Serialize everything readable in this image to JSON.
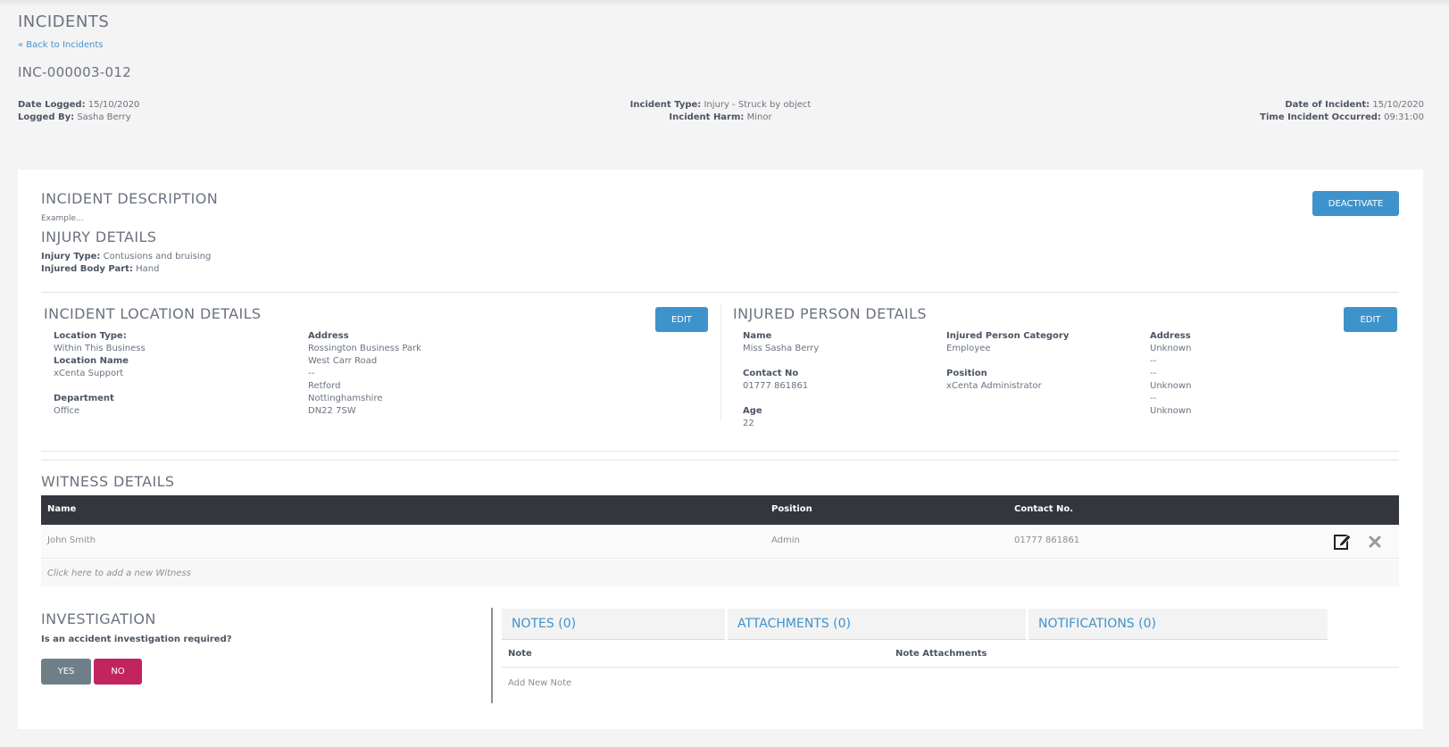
{
  "header": {
    "title": "INCIDENTS",
    "back_link": "« Back to Incidents",
    "reference": "INC-000003-012"
  },
  "meta": {
    "date_logged_label": "Date Logged:",
    "date_logged": "15/10/2020",
    "logged_by_label": "Logged By:",
    "logged_by": "Sasha Berry",
    "incident_type_label": "Incident Type:",
    "incident_type": "Injury - Struck by object",
    "incident_harm_label": "Incident Harm:",
    "incident_harm": "Minor",
    "date_of_incident_label": "Date of Incident:",
    "date_of_incident": "15/10/2020",
    "time_occurred_label": "Time Incident Occurred:",
    "time_occurred": "09:31:00"
  },
  "description": {
    "title": "INCIDENT DESCRIPTION",
    "text": "Example...",
    "deactivate_label": "DEACTIVATE"
  },
  "injury": {
    "title": "INJURY DETAILS",
    "type_label": "Injury Type:",
    "type": "Contusions and bruising",
    "body_part_label": "Injured Body Part:",
    "body_part": "Hand"
  },
  "location": {
    "title": "INCIDENT LOCATION DETAILS",
    "edit_label": "EDIT",
    "location_type_label": "Location Type:",
    "location_type": "Within This Business",
    "location_name_label": "Location Name",
    "location_name": "xCenta Support",
    "department_label": "Department",
    "department": "Office",
    "address_label": "Address",
    "address": [
      "Rossington Business Park",
      "West Carr Road",
      "--",
      "Retford",
      "Nottinghamshire",
      "DN22 7SW"
    ]
  },
  "person": {
    "title": "INJURED PERSON DETAILS",
    "edit_label": "EDIT",
    "name_label": "Name",
    "name": "Miss Sasha Berry",
    "contact_label": "Contact No",
    "contact": "01777 861861",
    "age_label": "Age",
    "age": "22",
    "category_label": "Injured Person Category",
    "category": "Employee",
    "position_label": "Position",
    "position": "xCenta Administrator",
    "address_label": "Address",
    "address": [
      "Unknown",
      "--",
      "--",
      "Unknown",
      "--",
      "Unknown"
    ]
  },
  "witness": {
    "title": "WITNESS DETAILS",
    "columns": [
      "Name",
      "Position",
      "Contact No."
    ],
    "rows": [
      {
        "name": "John Smith",
        "position": "Admin",
        "contact": "01777 861861"
      }
    ],
    "add_label": "Click here to add a new Witness"
  },
  "investigation": {
    "title": "INVESTIGATION",
    "question": "Is an accident investigation required?",
    "yes_label": "YES",
    "no_label": "NO"
  },
  "tabs": {
    "notes": "NOTES (0)",
    "attachments": "ATTACHMENTS (0)",
    "notifications": "NOTIFICATIONS (0)",
    "note_col": "Note",
    "attach_col": "Note Attachments",
    "add_note": "Add New Note"
  },
  "colors": {
    "accent": "#3f93cc",
    "danger": "#c2245f",
    "neutral_button": "#6e7f89",
    "table_header": "#33373d"
  }
}
